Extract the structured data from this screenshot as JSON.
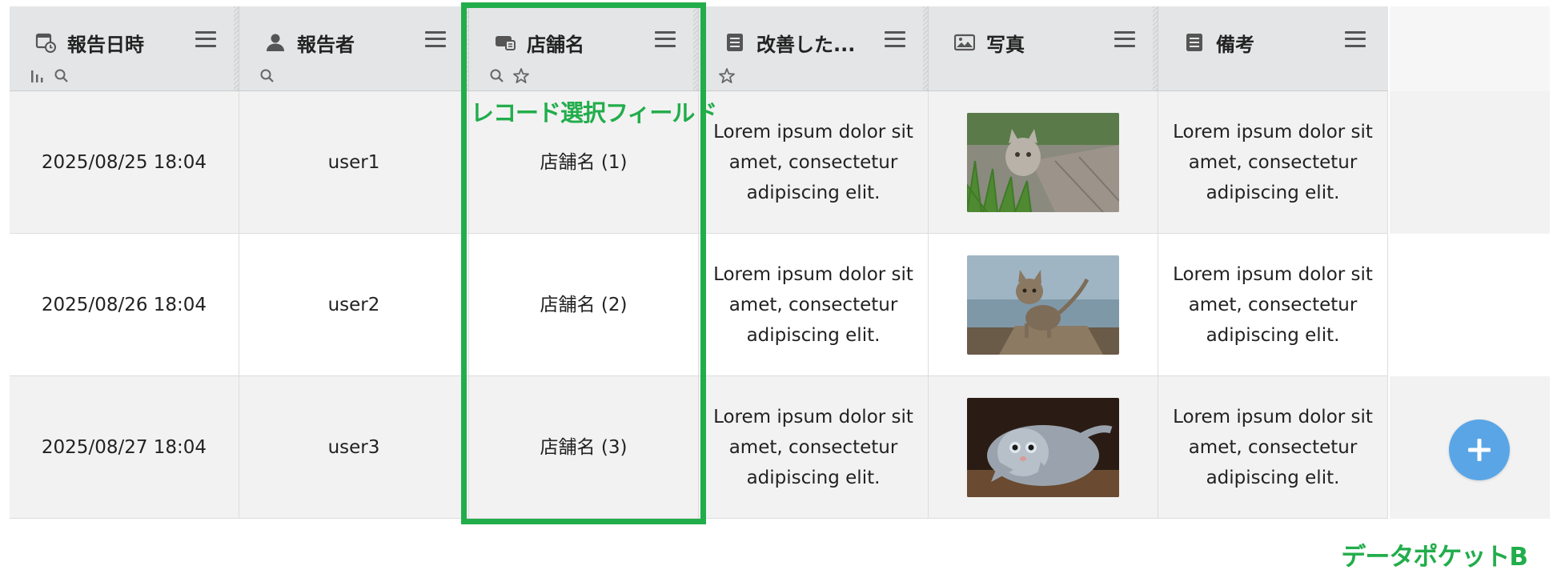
{
  "columns": [
    {
      "label": "報告日時",
      "icon": "datetime-icon",
      "tools": [
        "aggregate-icon",
        "search-icon"
      ]
    },
    {
      "label": "報告者",
      "icon": "user-icon",
      "tools": [
        "search-icon"
      ]
    },
    {
      "label": "店舗名",
      "icon": "record-select-icon",
      "tools": [
        "search-icon",
        "required-icon"
      ]
    },
    {
      "label": "改善した...",
      "icon": "textarea-icon",
      "tools": [
        "required-icon"
      ]
    },
    {
      "label": "写真",
      "icon": "image-icon",
      "tools": []
    },
    {
      "label": "備考",
      "icon": "textarea-icon",
      "tools": []
    }
  ],
  "rows": [
    {
      "datetime": "2025/08/25 18:04",
      "reporter": "user1",
      "store": "店舗名 (1)",
      "improvement": "Lorem ipsum dolor sit amet, consectetur adipiscing elit.",
      "photo": "cat in grass",
      "note": "Lorem ipsum dolor sit amet, consectetur adipiscing elit."
    },
    {
      "datetime": "2025/08/26 18:04",
      "reporter": "user2",
      "store": "店舗名 (2)",
      "improvement": "Lorem ipsum dolor sit amet, consectetur adipiscing elit.",
      "photo": "kitten walking",
      "note": "Lorem ipsum dolor sit amet, consectetur adipiscing elit."
    },
    {
      "datetime": "2025/08/27 18:04",
      "reporter": "user3",
      "store": "店舗名 (3)",
      "improvement": "Lorem ipsum dolor sit amet, consectetur adipiscing elit.",
      "photo": "cat lying on back",
      "note": "Lorem ipsum dolor sit amet, consectetur adipiscing elit."
    }
  ],
  "annotations": {
    "highlight_label": "レコード選択フィールド",
    "footer_label": "データポケットB"
  },
  "colors": {
    "accent_green": "#22ad4b",
    "fab_blue": "#5aa5e6",
    "header_bg": "#e4e5e6"
  }
}
